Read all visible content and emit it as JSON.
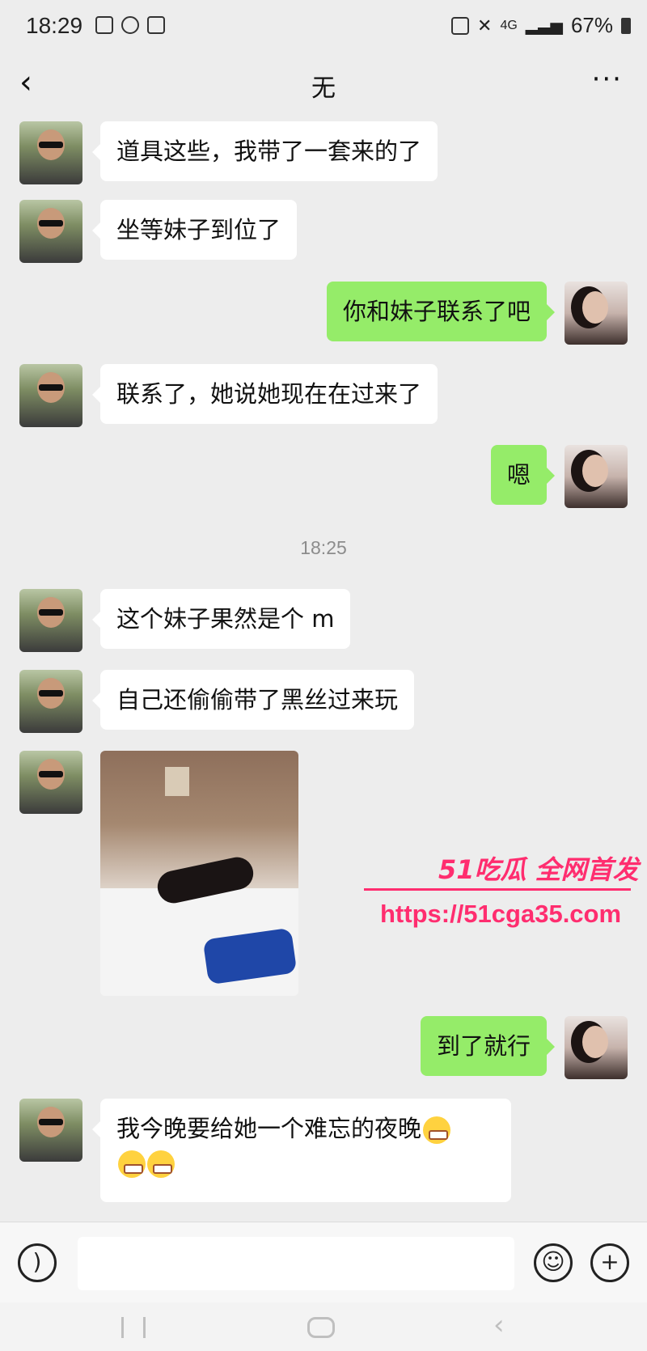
{
  "status_bar": {
    "time": "18:29",
    "network": "4G",
    "battery": "67%"
  },
  "header": {
    "back_icon": "chevron-left-icon",
    "title": "无",
    "more_label": "···"
  },
  "messages": [
    {
      "side": "in",
      "text": "道具这些，我带了一套来的了"
    },
    {
      "side": "in",
      "text": "坐等妹子到位了"
    },
    {
      "side": "out",
      "text": "你和妹子联系了吧"
    },
    {
      "side": "in",
      "text": "联系了，她说她现在在过来了"
    },
    {
      "side": "out",
      "text": "嗯"
    },
    {
      "side": "timestamp",
      "text": "18:25"
    },
    {
      "side": "in",
      "text": "这个妹子果然是个 m"
    },
    {
      "side": "in",
      "text": "自己还偷偷带了黑丝过来玩"
    },
    {
      "side": "in",
      "type": "image"
    },
    {
      "side": "out",
      "text": "到了就行"
    },
    {
      "side": "in",
      "text_line1": "我今晚要给她一个难忘的夜晚",
      "emoji": "grinning-face-emoji"
    }
  ],
  "watermark": {
    "line1": "51吃瓜 全网首发",
    "line2": "https://51cga35.com"
  },
  "input_bar": {
    "voice_icon": "voice-icon",
    "emoji_icon": "emoji-icon",
    "plus_icon": "plus-icon"
  },
  "colors": {
    "outgoing_bubble": "#95ec69",
    "incoming_bubble": "#ffffff",
    "background": "#ededed",
    "watermark": "#ff2d6f"
  }
}
